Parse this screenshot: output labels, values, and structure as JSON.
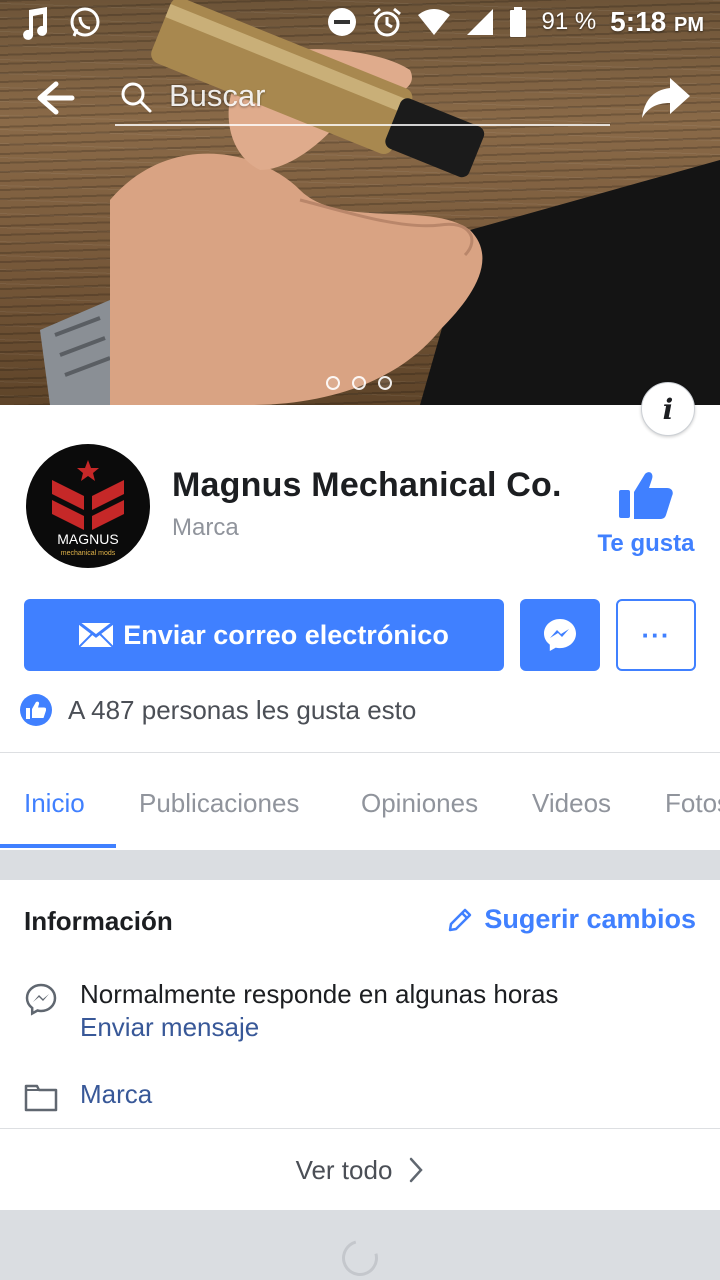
{
  "status_bar": {
    "battery_percent": "91 %",
    "time": "5:18",
    "ampm": "PM",
    "icons": [
      "music-note-icon",
      "whatsapp-icon",
      "do-not-disturb-icon",
      "alarm-icon",
      "wifi-icon",
      "signal-icon",
      "battery-icon"
    ]
  },
  "search": {
    "placeholder": "Buscar"
  },
  "cover": {
    "carousel_pages": 3,
    "active_page": 1
  },
  "page": {
    "name": "Magnus Mechanical Co.",
    "category": "Marca",
    "like_label": "Te gusta",
    "logo_text": "MAGNUS",
    "logo_subtext": "mechanical mods"
  },
  "actions": {
    "email_label": "Enviar correo electrónico",
    "more_label": "···"
  },
  "likes_text": "A 487 personas les gusta esto",
  "tabs": [
    "Inicio",
    "Publicaciones",
    "Opiniones",
    "Videos",
    "Fotos"
  ],
  "info": {
    "title": "Información",
    "suggest_label": "Sugerir cambios",
    "response_text": "Normalmente responde en algunas horas",
    "send_message": "Enviar mensaje",
    "brand": "Marca",
    "see_all": "Ver todo"
  },
  "colors": {
    "accent": "#4080ff",
    "link": "#385898",
    "muted": "#90949c"
  }
}
